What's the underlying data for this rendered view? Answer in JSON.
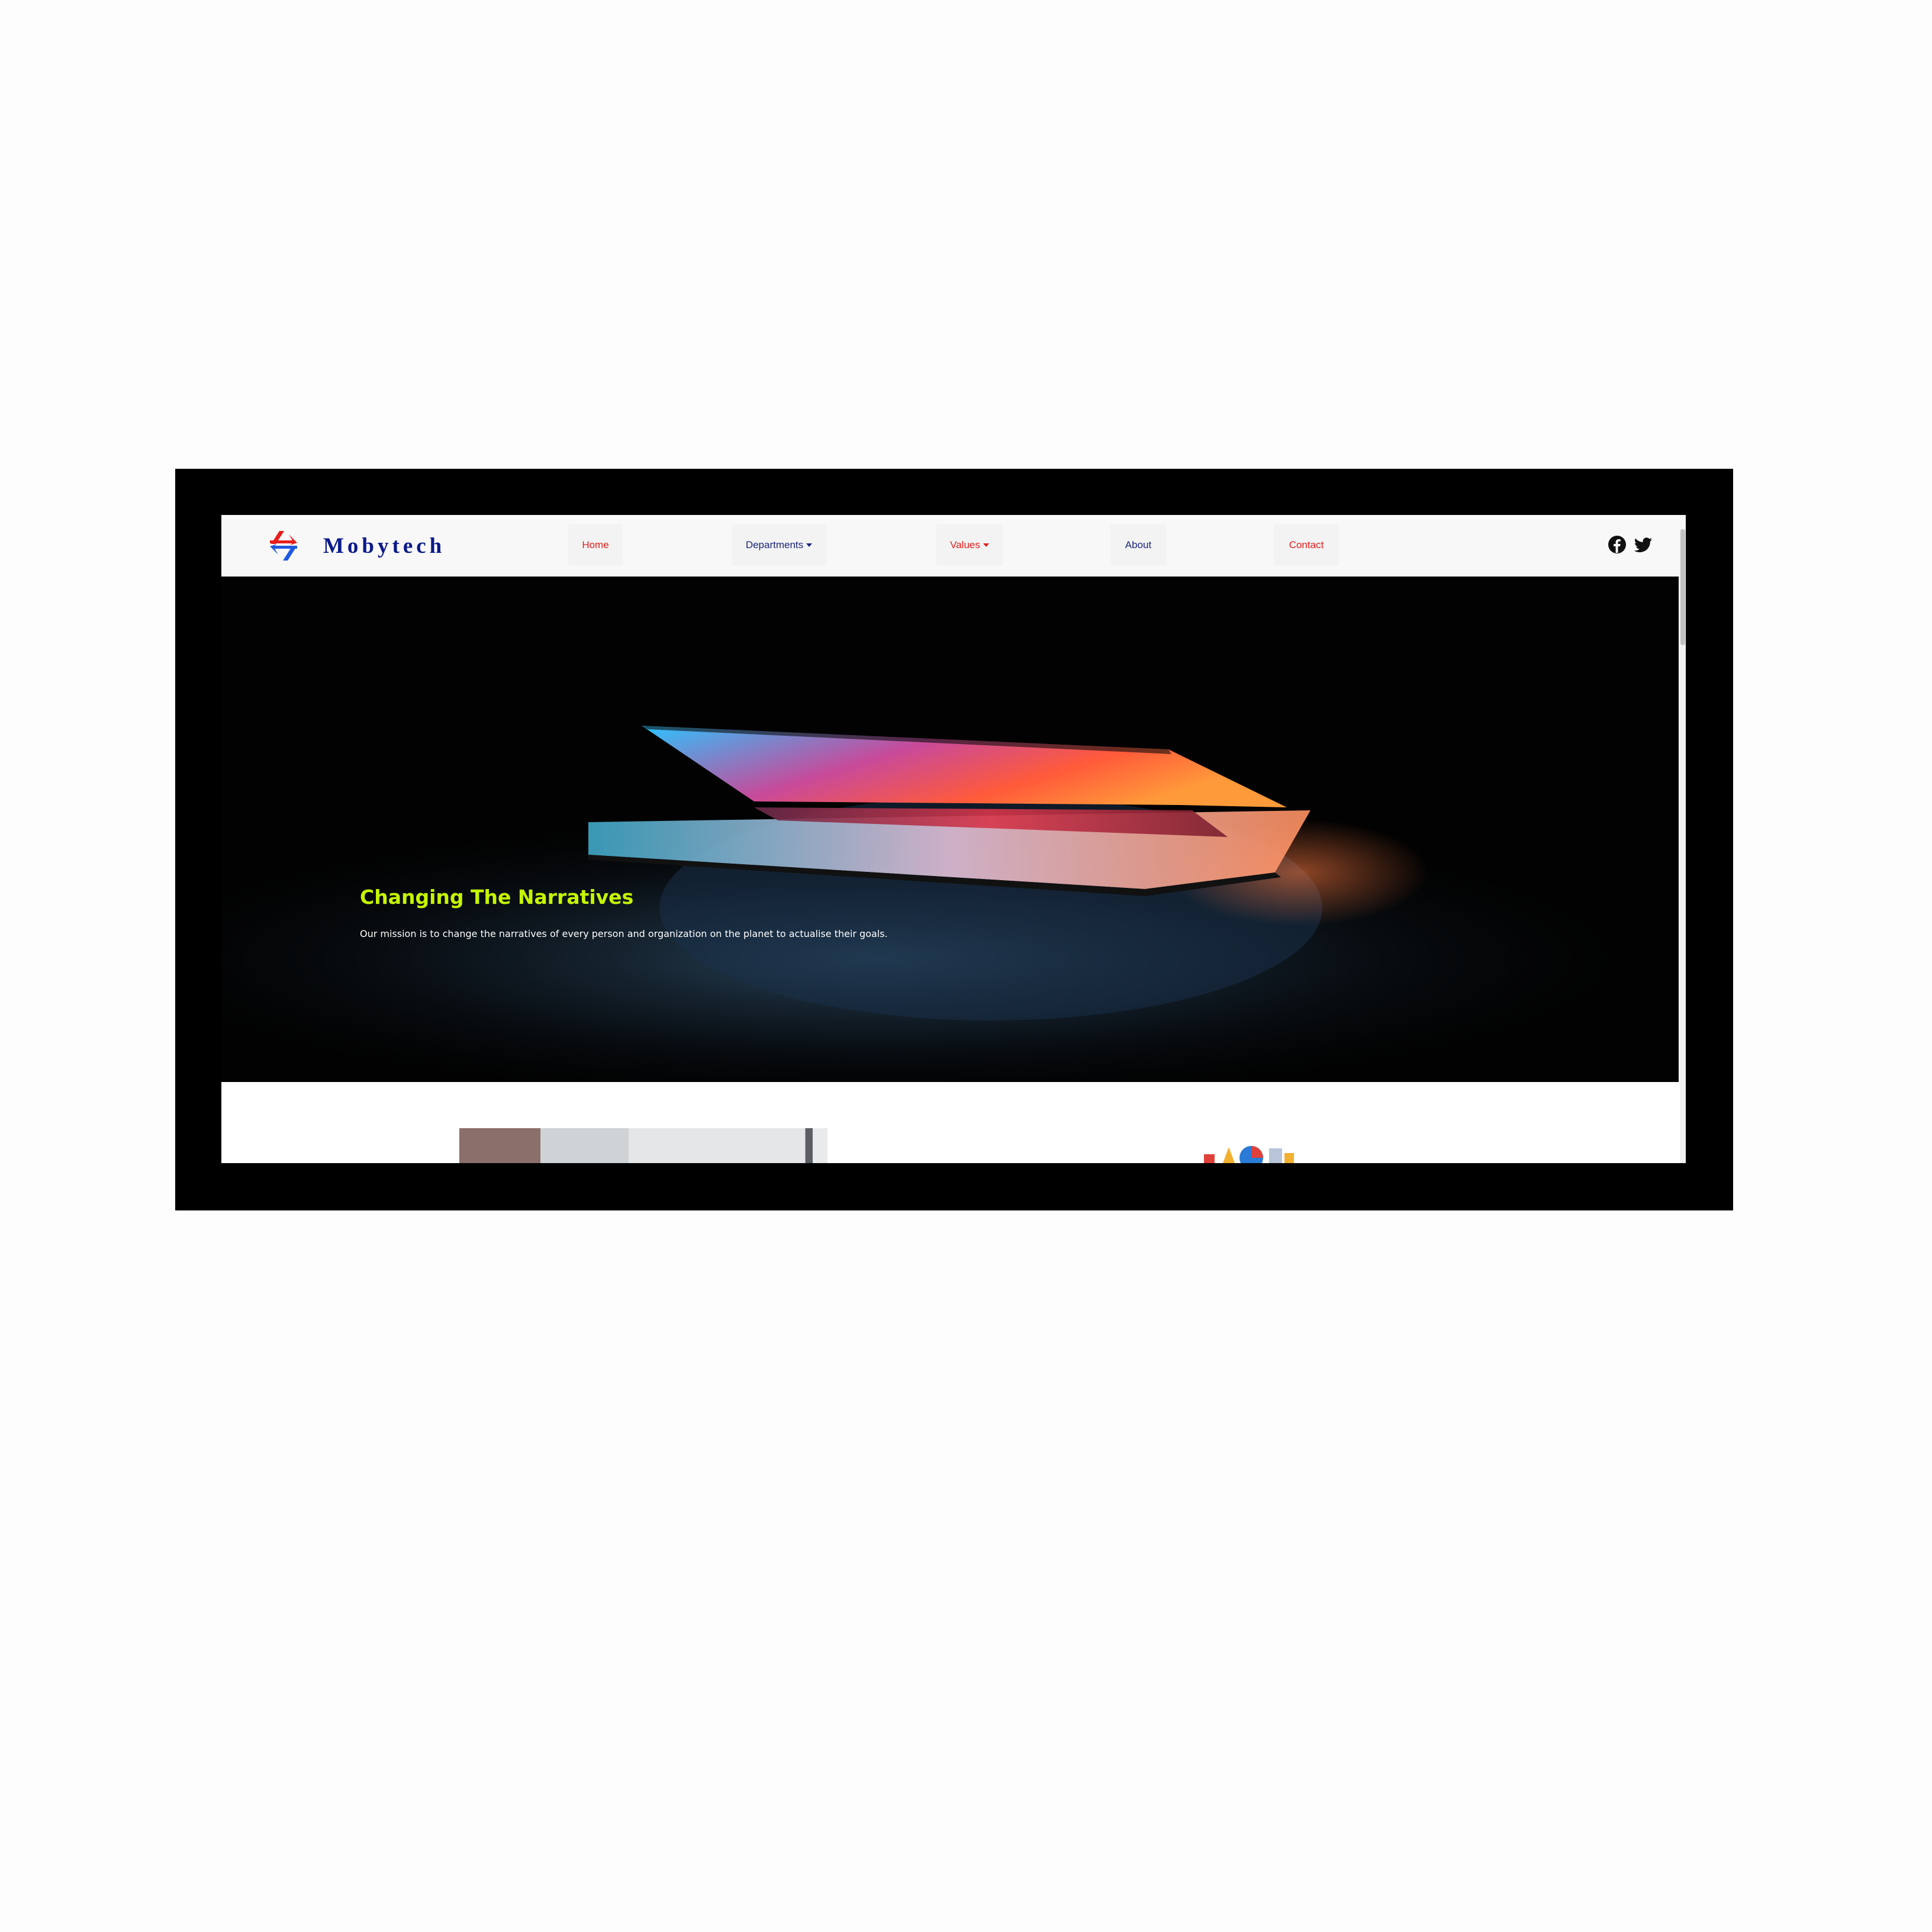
{
  "brand": {
    "name": "Mobytech",
    "logo_icon": "swap-arrows-logo",
    "logo_colors": [
      "#e81c1c",
      "#1e5ae0"
    ]
  },
  "nav": {
    "items": [
      {
        "label": "Home",
        "color": "#e81c1c",
        "dropdown": false
      },
      {
        "label": "Departments",
        "color": "#1a237e",
        "dropdown": true
      },
      {
        "label": "Values",
        "color": "#e81c1c",
        "dropdown": true
      },
      {
        "label": "About",
        "color": "#1a237e",
        "dropdown": false
      },
      {
        "label": "Contact",
        "color": "#e81c1c",
        "dropdown": false
      }
    ]
  },
  "social": {
    "icons": [
      "facebook-icon",
      "twitter-icon"
    ]
  },
  "hero": {
    "heading": "Changing The Narratives",
    "text": "Our mission is to change the narratives of every person and organization on the planet to actualise their goals.",
    "heading_color": "#c6f500",
    "image": "glowing-laptop-photo"
  },
  "colors": {
    "frame": "#000000",
    "navbar_bg": "#f8f8f8",
    "brand_text": "#0a1a8a"
  }
}
